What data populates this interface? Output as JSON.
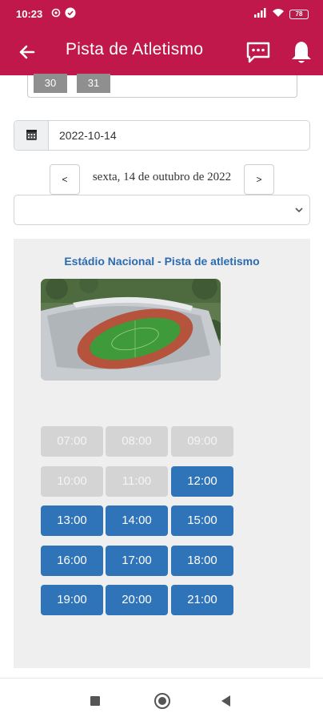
{
  "status_bar": {
    "time": "10:23",
    "battery": "78",
    "icons": [
      "settings-icon",
      "check-circle-icon",
      "signal-icon",
      "wifi-icon",
      "battery-icon"
    ]
  },
  "app_bar": {
    "title": "Pista de Atletismo",
    "icons": [
      "back-arrow-icon",
      "chat-icon",
      "bell-icon"
    ]
  },
  "calendar": {
    "visible_days": [
      "30",
      "31"
    ]
  },
  "date_picker": {
    "value": "2022-10-14",
    "icon": "calendar-icon"
  },
  "day_nav": {
    "prev_label": "<",
    "next_label": ">",
    "current_day": "sexta, 14 de outubro de 2022"
  },
  "select": {
    "value": ""
  },
  "facility": {
    "name": "Estádio Nacional - Pista de atletismo",
    "image": "stadium-aerial-photo"
  },
  "time_slots": [
    {
      "time": "07:00",
      "available": false
    },
    {
      "time": "08:00",
      "available": false
    },
    {
      "time": "09:00",
      "available": false
    },
    {
      "time": "10:00",
      "available": false
    },
    {
      "time": "11:00",
      "available": false
    },
    {
      "time": "12:00",
      "available": true
    },
    {
      "time": "13:00",
      "available": true
    },
    {
      "time": "14:00",
      "available": true
    },
    {
      "time": "15:00",
      "available": true
    },
    {
      "time": "16:00",
      "available": true
    },
    {
      "time": "17:00",
      "available": true
    },
    {
      "time": "18:00",
      "available": true
    },
    {
      "time": "19:00",
      "available": true
    },
    {
      "time": "20:00",
      "available": true
    },
    {
      "time": "21:00",
      "available": true
    }
  ],
  "colors": {
    "brand": "#c0184b",
    "slot_available": "#2f74b9",
    "slot_unavailable": "#d4d4d4",
    "facility_title": "#2c6bb0"
  }
}
